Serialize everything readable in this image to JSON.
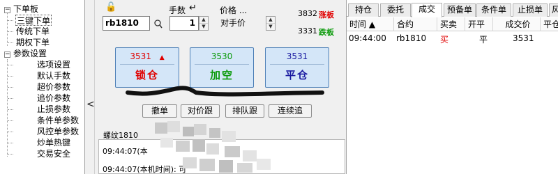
{
  "tree": {
    "groups": [
      {
        "label": "下单板",
        "children": [
          "三键下单",
          "传统下单",
          "期权下单"
        ]
      },
      {
        "label": "参数设置",
        "children": [
          "选项设置",
          "默认手数",
          "超价参数",
          "追价参数",
          "止损参数",
          "条件单参数",
          "风控单参数",
          "炒单热键",
          "交易安全"
        ]
      }
    ],
    "selected": "三键下单"
  },
  "collapse_glyph": "<",
  "order": {
    "lock_glyph": "🔓",
    "qty_label": "手数",
    "return_glyph": "↵",
    "price_label": "价格 ...",
    "contract": "rb1810",
    "qty": "1",
    "price_mode": "对手价",
    "upper_limit_price": "3832",
    "upper_limit_label": "涨板",
    "lower_limit_price": "3331",
    "lower_limit_label": "跌板",
    "buttons": [
      {
        "price": "3531",
        "marker": "▲",
        "label": "锁仓",
        "color": "#e00000"
      },
      {
        "price": "3530",
        "marker": "",
        "label": "加空",
        "color": "#0a9a0a"
      },
      {
        "price": "3531",
        "marker": "",
        "label": "平仓",
        "color": "#1a1aa0"
      }
    ],
    "small_buttons": [
      "撤单",
      "对价跟",
      "排队跟",
      "连续追"
    ]
  },
  "log": {
    "title": "螺纹1810",
    "lines": [
      "09:44:07(本",
      "09:44:07(本机时间): 可"
    ]
  },
  "trade": {
    "tabs": [
      "持仓",
      "委托",
      "成交",
      "预备单",
      "条件单",
      "止损单",
      "风"
    ],
    "active_tab": "成交",
    "columns": [
      "时间 ▲",
      "合约",
      "买卖",
      "开平",
      "成交价",
      "平仓"
    ],
    "rows": [
      {
        "time": "09:44:00",
        "contract": "rb1810",
        "side": "买",
        "offset": "平",
        "price": "3531"
      }
    ],
    "side_buy_color": "#e00000"
  }
}
